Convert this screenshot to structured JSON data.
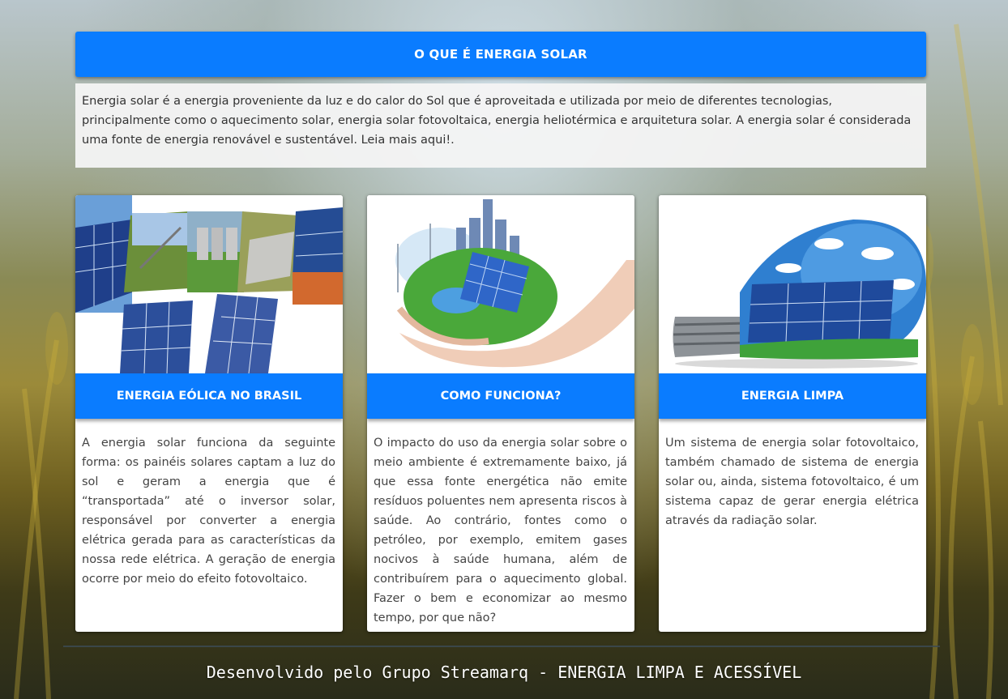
{
  "intro": {
    "title": "O QUE É ENERGIA SOLAR",
    "text": "Energia solar é a energia proveniente da luz e do calor do Sol que é aproveitada e utilizada por meio de diferentes tecnologias, principalmente como o aquecimento solar, energia solar fotovoltaica, energia heliotérmica e arquitetura solar. A energia solar é considerada uma fonte de energia renovável e sustentável. Leia mais aqui!."
  },
  "cards": [
    {
      "title": "ENERGIA EÓLICA NO BRASIL",
      "image": "solar-panels-collage",
      "text": "A energia solar funciona da seguinte forma: os painéis solares captam a luz do sol e geram a energia que é “transportada” até o inversor solar, responsável por converter a energia elétrica gerada para as características da nossa rede elétrica. A geração de energia ocorre por meio do efeito fotovoltaico."
    },
    {
      "title": "COMO FUNCIONA?",
      "image": "hands-holding-green-earth",
      "text": "O impacto do uso da energia solar sobre o meio ambiente é extremamente baixo, já que essa fonte energética não emite resíduos poluentes nem apresenta riscos à saúde. Ao contrário, fontes como o petróleo, por exemplo, emitem gases nocivos à saúde humana, além de contribuírem para o aquecimento global. Fazer o bem e economizar ao mesmo tempo, por que não?"
    },
    {
      "title": "ENERGIA LIMPA",
      "image": "light-bulb-with-solar-panels",
      "text": "Um sistema de energia solar fotovoltaico, também chamado de sistema de energia solar ou, ainda, sistema fotovoltaico, é um sistema capaz de gerar energia elétrica através da radiação solar."
    }
  ],
  "footer": {
    "text": "Desenvolvido pelo Grupo Streamarq - ENERGIA LIMPA E ACESSÍVEL"
  }
}
